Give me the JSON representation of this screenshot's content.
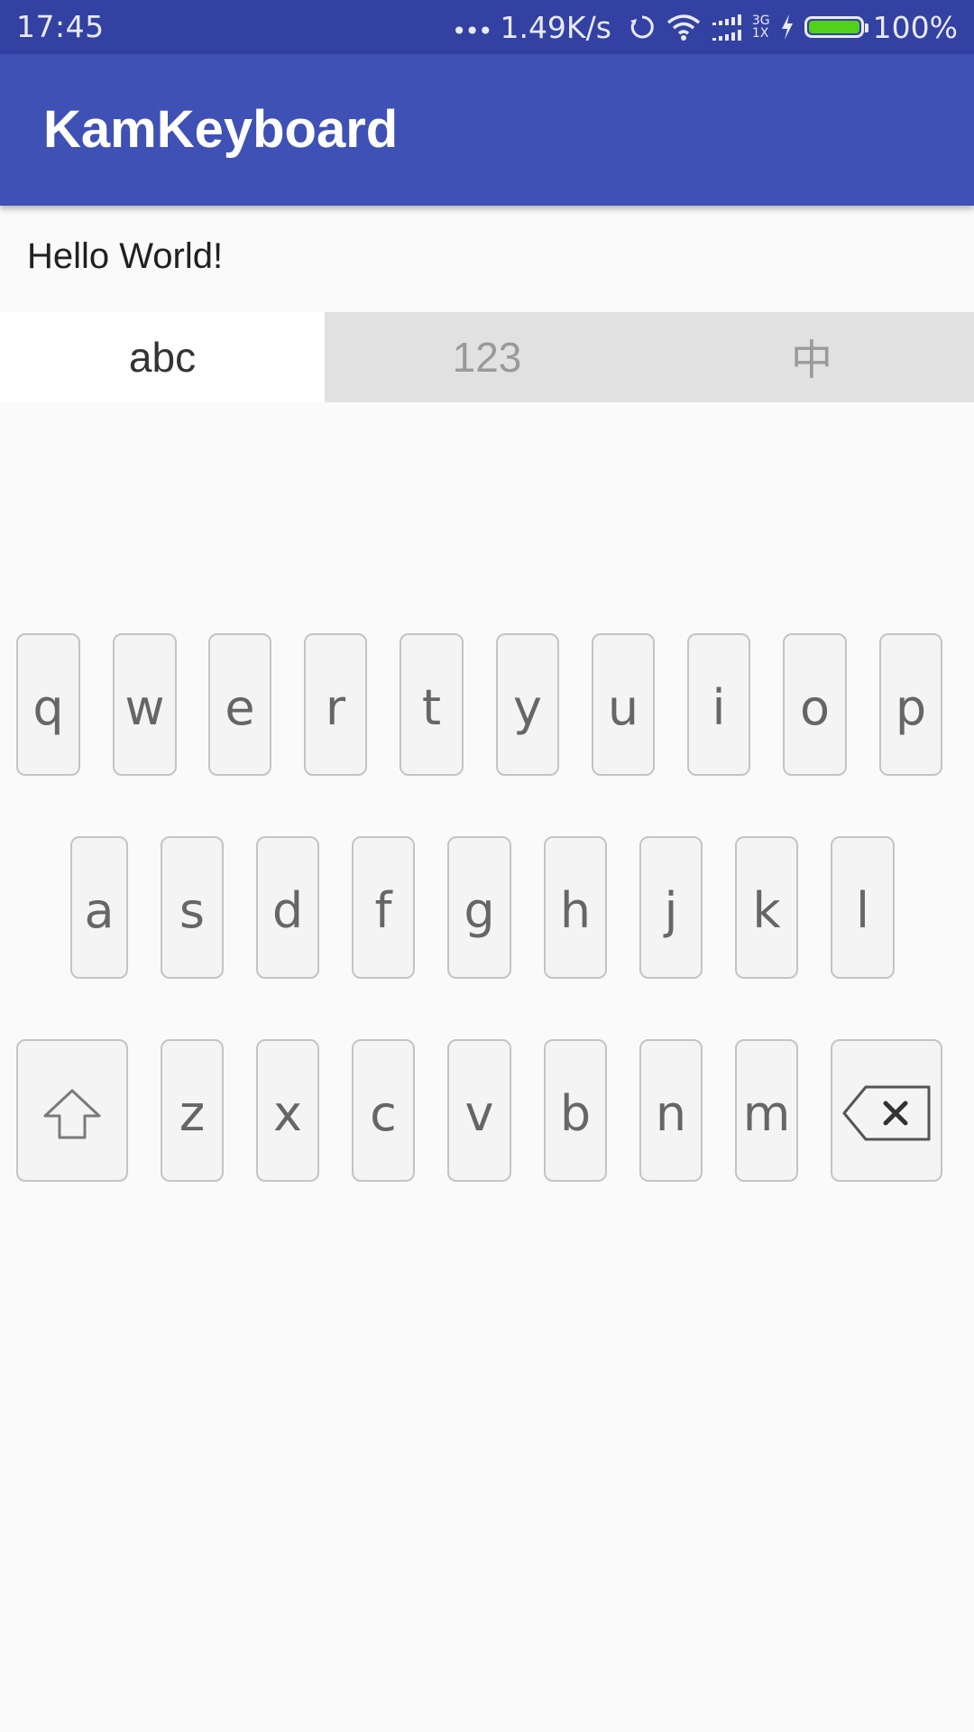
{
  "status_bar": {
    "time": "17:45",
    "dots": "•••",
    "net_speed": "1.49K/s",
    "net_type_top": "3G",
    "net_type_bottom": "1X",
    "battery_level": 1.0,
    "battery_text": "100%",
    "battery_color": "#4fd218"
  },
  "app_bar": {
    "title": "KamKeyboard",
    "color": "#3f51b5"
  },
  "content": {
    "text": "Hello World!"
  },
  "tabs": [
    {
      "label": "abc",
      "active": true
    },
    {
      "label": "123",
      "active": false
    },
    {
      "label": "中",
      "active": false
    }
  ],
  "keyboard": {
    "row1": [
      "q",
      "w",
      "e",
      "r",
      "t",
      "y",
      "u",
      "i",
      "o",
      "p"
    ],
    "row2": [
      "a",
      "s",
      "d",
      "f",
      "g",
      "h",
      "j",
      "k",
      "l"
    ],
    "row3": [
      "z",
      "x",
      "c",
      "v",
      "b",
      "n",
      "m"
    ],
    "shift_icon": "shift-arrow-icon",
    "delete_icon": "backspace-icon"
  }
}
